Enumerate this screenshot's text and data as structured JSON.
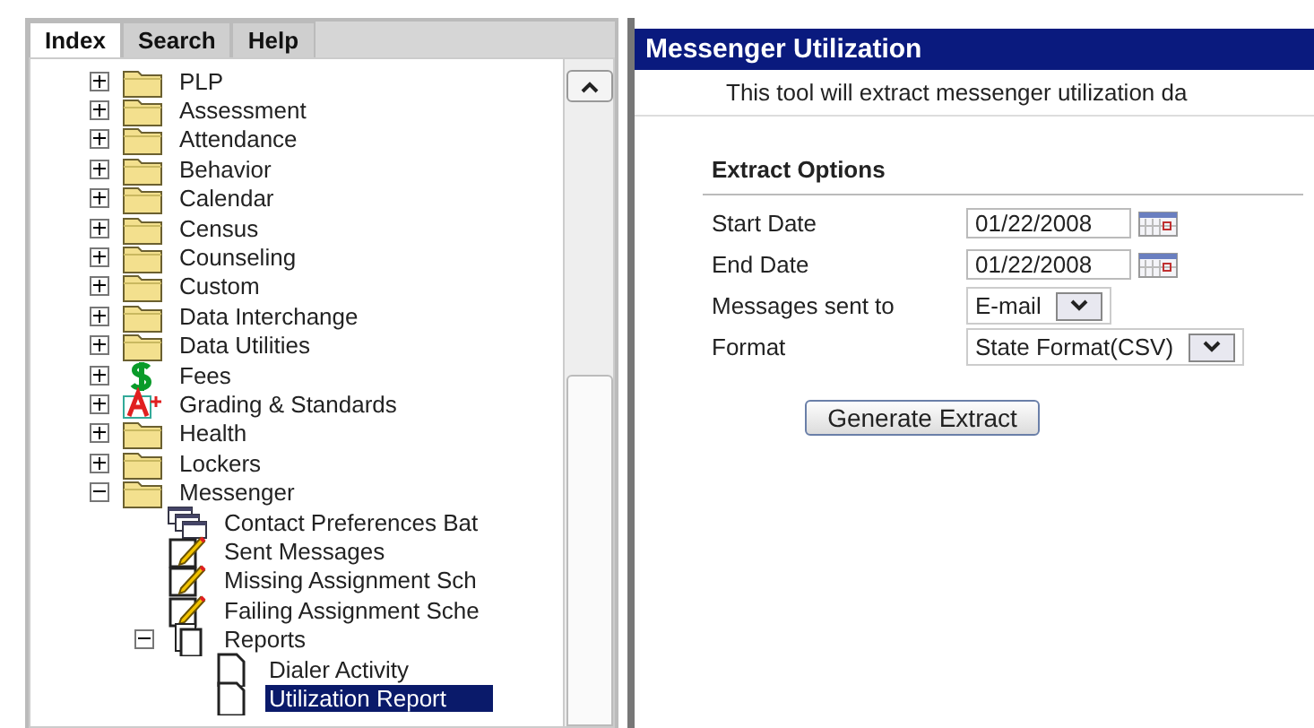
{
  "tabs": [
    {
      "label": "Index",
      "selected": true
    },
    {
      "label": "Search",
      "selected": false
    },
    {
      "label": "Help",
      "selected": false
    }
  ],
  "tree": [
    {
      "label": "PLP",
      "kind": "folder",
      "expanded": false,
      "selected": false
    },
    {
      "label": "Assessment",
      "kind": "folder",
      "expanded": false,
      "selected": false
    },
    {
      "label": "Attendance",
      "kind": "folder",
      "expanded": false,
      "selected": false
    },
    {
      "label": "Behavior",
      "kind": "folder",
      "expanded": false,
      "selected": false
    },
    {
      "label": "Calendar",
      "kind": "folder",
      "expanded": false,
      "selected": false
    },
    {
      "label": "Census",
      "kind": "folder",
      "expanded": false,
      "selected": false
    },
    {
      "label": "Counseling",
      "kind": "folder",
      "expanded": false,
      "selected": false
    },
    {
      "label": "Custom",
      "kind": "folder",
      "expanded": false,
      "selected": false
    },
    {
      "label": "Data Interchange",
      "kind": "folder",
      "expanded": false,
      "selected": false
    },
    {
      "label": "Data Utilities",
      "kind": "folder",
      "expanded": false,
      "selected": false
    },
    {
      "label": "Fees",
      "kind": "dollar",
      "expanded": false,
      "selected": false
    },
    {
      "label": "Grading & Standards",
      "kind": "grade",
      "expanded": false,
      "selected": false
    },
    {
      "label": "Health",
      "kind": "folder",
      "expanded": false,
      "selected": false
    },
    {
      "label": "Lockers",
      "kind": "folder",
      "expanded": false,
      "selected": false
    },
    {
      "label": "Messenger",
      "kind": "folder",
      "expanded": true,
      "selected": false,
      "children": [
        {
          "label": "Contact Preferences Bat",
          "kind": "windows",
          "selected": false
        },
        {
          "label": "Sent Messages",
          "kind": "note",
          "selected": false
        },
        {
          "label": "Missing Assignment Sch",
          "kind": "note",
          "selected": false
        },
        {
          "label": "Failing Assignment Sche",
          "kind": "note",
          "selected": false
        },
        {
          "label": "Reports",
          "kind": "pages",
          "expanded": true,
          "selected": false,
          "children": [
            {
              "label": "Dialer Activity",
              "kind": "page",
              "selected": false
            },
            {
              "label": "Utilization Report",
              "kind": "page",
              "selected": true
            }
          ]
        }
      ]
    }
  ],
  "form": {
    "title": "Messenger Utilization",
    "description": "This tool will extract messenger utilization da",
    "section": "Extract Options",
    "fields": [
      {
        "label": "Start Date",
        "kind": "date",
        "value": "01/22/2008"
      },
      {
        "label": "End Date",
        "kind": "date",
        "value": "01/22/2008"
      },
      {
        "label": "Messages sent to",
        "kind": "select",
        "value": "E-mail"
      },
      {
        "label": "Format",
        "kind": "select",
        "value": "State Format(CSV)"
      }
    ],
    "button": "Generate Extract"
  }
}
